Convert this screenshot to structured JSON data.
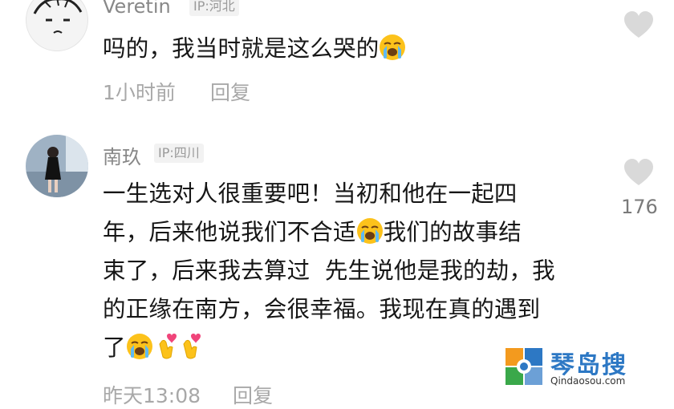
{
  "comments": [
    {
      "username": "Veretin",
      "ip": "IP:河北",
      "text_before_emoji": "吗的，我当时就是这么哭的",
      "time": "1小时前",
      "reply_label": "回复"
    },
    {
      "username": "南玖",
      "ip": "IP:四川",
      "lines": [
        "一生选对人很重要吧！当初和他在一起四",
        "年，后来他说我们不合适",
        "我们的故事结",
        "束了，后来我去算过  先生说他是我的劫，我",
        "的正缘在南方，会很幸福。我现在真的遇到",
        "了"
      ],
      "likes": "176",
      "time": "昨天13:08",
      "reply_label": "回复"
    }
  ],
  "icons": {
    "like": "heart-icon",
    "crying": "loudly-crying-face-emoji",
    "finger_heart": "finger-heart-emoji"
  },
  "watermark": {
    "title": "琴岛搜",
    "url": "Qindaosou.com"
  },
  "colors": {
    "text": "#161616",
    "meta": "#a8a8a8",
    "heart": "#d9d9d9",
    "watermark_blue": "#2d78c4"
  }
}
